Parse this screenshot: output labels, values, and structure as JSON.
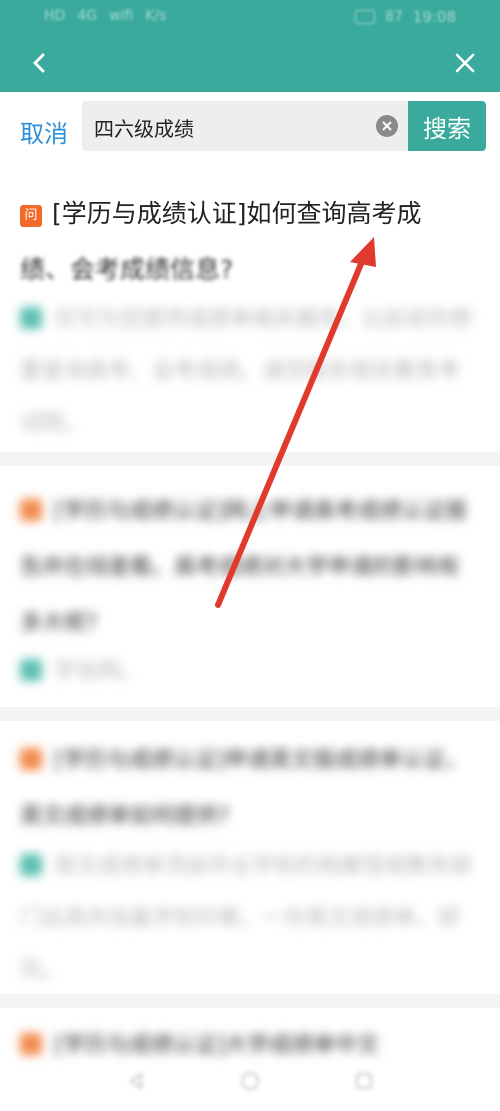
{
  "status_bar": {
    "left_items": [
      "HD",
      "4G",
      "wifi",
      "K/s"
    ],
    "time": "19:08",
    "battery": "87"
  },
  "nav": {
    "back_icon": "chevron-left-icon",
    "close_icon": "close-icon"
  },
  "search": {
    "cancel_label": "取消",
    "query": "四六级成绩",
    "search_button_label": "搜索",
    "clear_icon": "clear-icon"
  },
  "results": [
    {
      "badge": "问",
      "title_line1": "[学历与成绩认证]如何查询高考成",
      "title_line2": "绩、会考成绩信息?",
      "snippet": "仅可为您提供成绩单相关服务。比如说你想要查询高考、会考成绩。请您联系相关教育考试院。"
    },
    {
      "title": "[学历与成绩认证]网上申请高考成绩认证报告并在线查看。高考成绩对大学申请的影响有多大呢?",
      "snippet": "学信网。"
    },
    {
      "title": "[学历与成绩认证]申请英文版成绩单认证，英文成绩单如何提供?",
      "snippet": "英文成绩单须由毕业学校的档案馆或教务部门出具并加盖学校印章。一份英文成绩单，研究。"
    },
    {
      "title": "[学历与成绩认证]大学成绩单中文"
    }
  ],
  "bottom_nav": {
    "items": [
      "back-triangle-icon",
      "home-circle-icon",
      "recent-square-icon"
    ]
  },
  "colors": {
    "header": "#3aaa9c",
    "accent_blue": "#2e8fd8",
    "badge_orange": "#f26b2b",
    "arrow": "#e03a2e"
  }
}
